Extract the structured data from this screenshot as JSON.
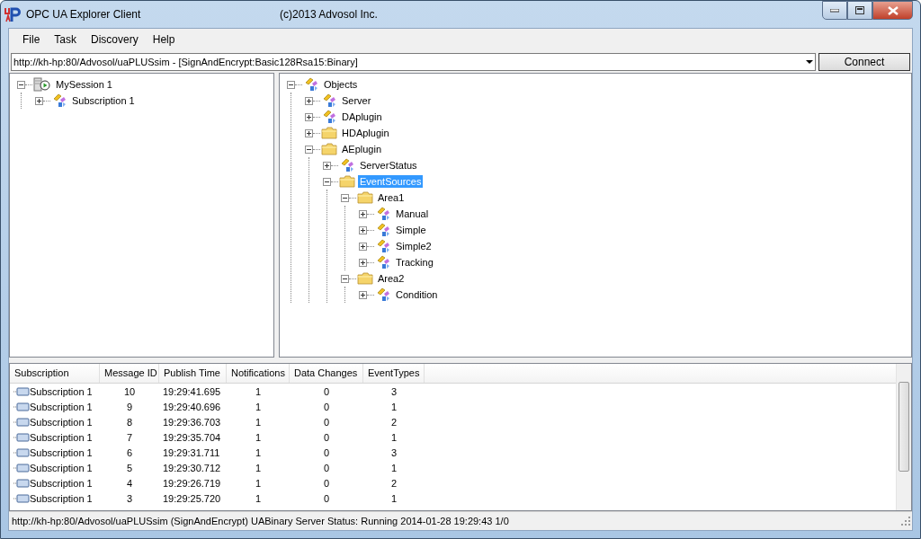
{
  "window": {
    "title": "OPC UA Explorer Client",
    "copyright": "(c)2013  Advosol Inc."
  },
  "menu": [
    "File",
    "Task",
    "Discovery",
    "Help"
  ],
  "endpoint": {
    "value": "http://kh-hp:80/Advosol/uaPLUSsim - [SignAndEncrypt:Basic128Rsa15:Binary]",
    "button": "Connect"
  },
  "session_tree": [
    {
      "label": "MySession 1",
      "kind": "session",
      "expanded": true,
      "selected": false,
      "children": [
        {
          "label": "Subscription 1",
          "kind": "object",
          "expanded": false,
          "selected": false
        }
      ]
    }
  ],
  "address_tree": [
    {
      "label": "Objects",
      "kind": "object",
      "expanded": true,
      "selected": false,
      "children": [
        {
          "label": "Server",
          "kind": "object",
          "expanded": false,
          "selected": false
        },
        {
          "label": "DAplugin",
          "kind": "object",
          "expanded": false,
          "selected": false
        },
        {
          "label": "HDAplugin",
          "kind": "folder",
          "expanded": false,
          "selected": false
        },
        {
          "label": "AEplugin",
          "kind": "folder",
          "expanded": true,
          "selected": false,
          "children": [
            {
              "label": "ServerStatus",
              "kind": "object",
              "expanded": false,
              "selected": false
            },
            {
              "label": "EventSources",
              "kind": "folder",
              "expanded": true,
              "selected": true,
              "children": [
                {
                  "label": "Area1",
                  "kind": "folder",
                  "expanded": true,
                  "selected": false,
                  "children": [
                    {
                      "label": "Manual",
                      "kind": "object",
                      "expanded": false,
                      "selected": false
                    },
                    {
                      "label": "Simple",
                      "kind": "object",
                      "expanded": false,
                      "selected": false
                    },
                    {
                      "label": "Simple2",
                      "kind": "object",
                      "expanded": false,
                      "selected": false
                    },
                    {
                      "label": "Tracking",
                      "kind": "object",
                      "expanded": false,
                      "selected": false
                    }
                  ]
                },
                {
                  "label": "Area2",
                  "kind": "folder",
                  "expanded": true,
                  "selected": false,
                  "children": [
                    {
                      "label": "Condition",
                      "kind": "object",
                      "expanded": false,
                      "selected": false
                    }
                  ]
                }
              ]
            }
          ]
        }
      ]
    }
  ],
  "messages": {
    "columns": [
      "Subscription",
      "Message ID",
      "Publish Time",
      "Notifications",
      "Data Changes",
      "EventTypes"
    ],
    "rows": [
      [
        "Subscription 1",
        "10",
        "19:29:41.695",
        "1",
        "0",
        "3"
      ],
      [
        "Subscription 1",
        "9",
        "19:29:40.696",
        "1",
        "0",
        "1"
      ],
      [
        "Subscription 1",
        "8",
        "19:29:36.703",
        "1",
        "0",
        "2"
      ],
      [
        "Subscription 1",
        "7",
        "19:29:35.704",
        "1",
        "0",
        "1"
      ],
      [
        "Subscription 1",
        "6",
        "19:29:31.711",
        "1",
        "0",
        "3"
      ],
      [
        "Subscription 1",
        "5",
        "19:29:30.712",
        "1",
        "0",
        "1"
      ],
      [
        "Subscription 1",
        "4",
        "19:29:26.719",
        "1",
        "0",
        "2"
      ],
      [
        "Subscription 1",
        "3",
        "19:29:25.720",
        "1",
        "0",
        "1"
      ]
    ]
  },
  "status_bar": "http://kh-hp:80/Advosol/uaPLUSsim (SignAndEncrypt) UABinary  Server Status: Running 2014-01-28 19:29:43 1/0"
}
